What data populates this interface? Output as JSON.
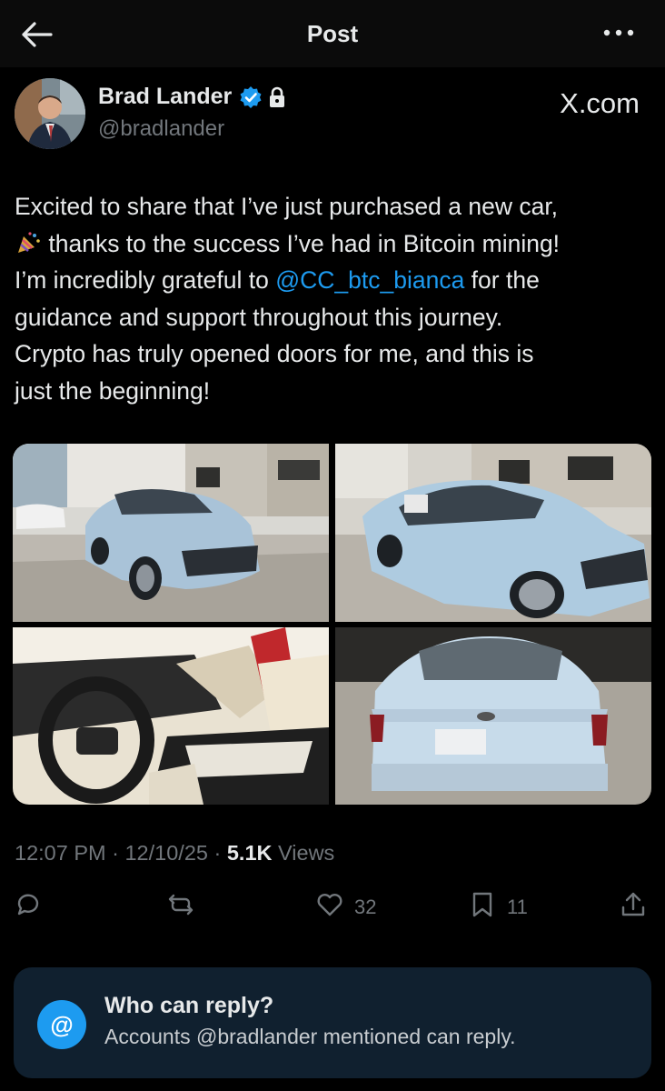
{
  "header": {
    "title": "Post"
  },
  "author": {
    "name": "Brad Lander",
    "handle": "@bradlander",
    "verified": true,
    "locked": true
  },
  "source_watermark": "X.com",
  "tweet": {
    "line1": "Excited to share that I’ve just purchased a new car,",
    "line2": " thanks to the success I’ve had in Bitcoin mining!",
    "line3_pre": "I’m incredibly grateful to ",
    "mention": "@CC_btc_bianca",
    "line3_post": " for the",
    "line4": "guidance and support throughout this journey.",
    "line5": "Crypto has truly opened doors for me, and this is",
    "line6": "just the beginning!"
  },
  "meta": {
    "time": "12:07 PM",
    "sep1": " · ",
    "date": "12/10/25",
    "sep2": " · ",
    "views_count": "5.1K",
    "views_label": " Views"
  },
  "actions": {
    "likes": "32",
    "bookmarks": "11"
  },
  "reply_settings": {
    "title": "Who can reply?",
    "subtitle": "Accounts @bradlander mentioned can reply.",
    "icon_text": "@"
  },
  "colors": {
    "background": "#000000",
    "accent": "#1d9bf0",
    "muted": "#71767b",
    "panel": "#10202f"
  },
  "icons": [
    "back-arrow-icon",
    "more-icon",
    "verified-badge-icon",
    "lock-icon",
    "confetti-icon",
    "reply-icon",
    "retweet-icon",
    "like-icon",
    "bookmark-icon",
    "share-icon",
    "mention-icon"
  ]
}
